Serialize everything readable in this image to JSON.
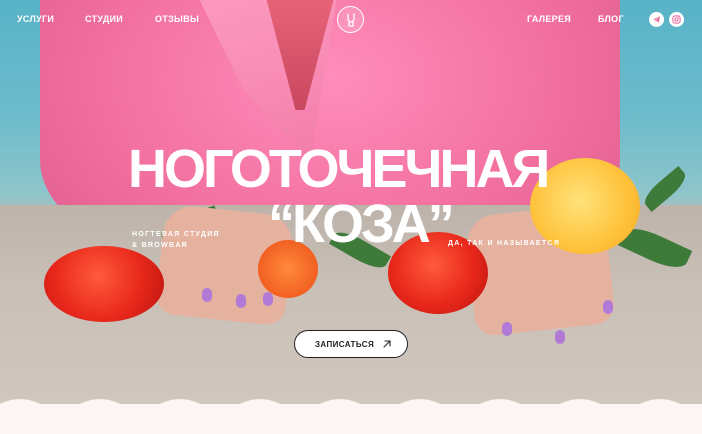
{
  "nav": {
    "left": [
      {
        "label": "УСЛУГИ"
      },
      {
        "label": "СТУДИИ"
      },
      {
        "label": "ОТЗЫВЫ"
      }
    ],
    "right": [
      {
        "label": "ГАЛЕРЕЯ"
      },
      {
        "label": "БЛОГ"
      }
    ],
    "social_icons": [
      "telegram-icon",
      "instagram-icon"
    ],
    "logo_icon": "goat-hand-logo-icon"
  },
  "hero": {
    "title_line1": "НОГОТОЧЕЧНАЯ",
    "title_line2": "“КОЗА”",
    "subtitle_left_line1": "НОГТЕВАЯ СТУДИЯ",
    "subtitle_left_line2": "& BROWBAR",
    "subtitle_right": "ДА, ТАК И НАЗЫВАЕТСЯ",
    "cta_label": "ЗАПИСАТЬСЯ"
  },
  "colors": {
    "text_on_hero": "#ffffff",
    "page_background": "#fdf6f4",
    "jacket_pink": "#f2709f",
    "sky_blue": "#57b3c7"
  }
}
